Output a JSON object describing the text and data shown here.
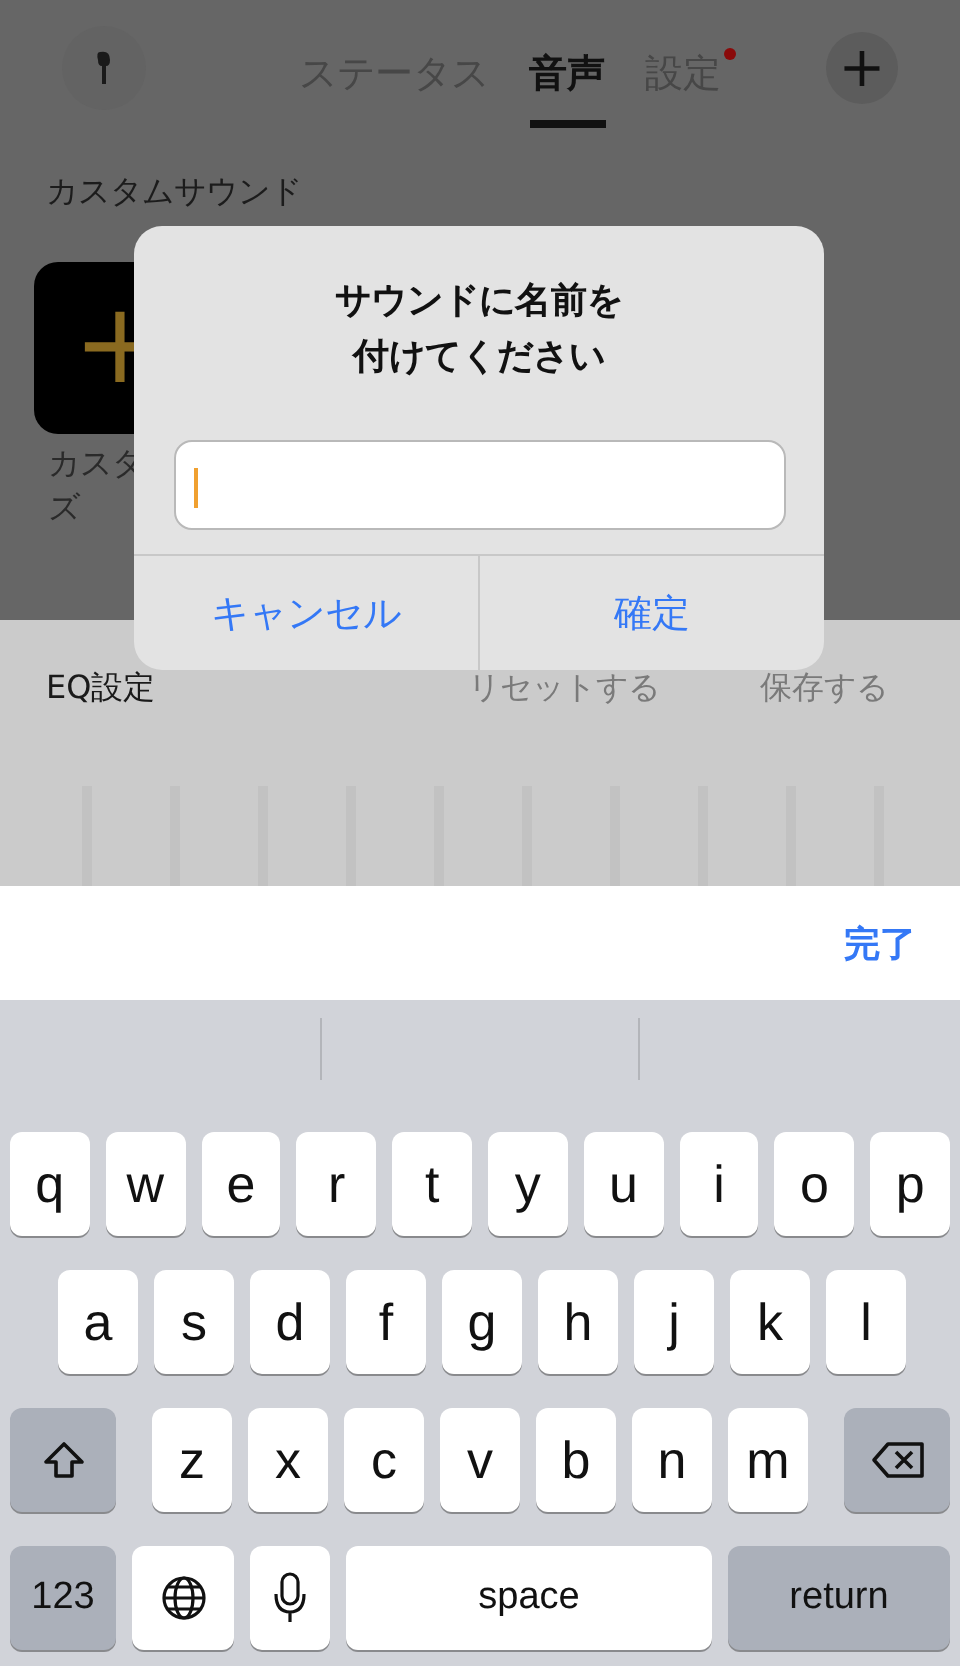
{
  "header": {
    "tabs": [
      {
        "label": "ステータス",
        "selected": false,
        "dot": false
      },
      {
        "label": "音声",
        "selected": true,
        "dot": false
      },
      {
        "label": "設定",
        "selected": false,
        "dot": true
      }
    ],
    "add_button": "+"
  },
  "custom_sound": {
    "title": "カスタムサウンド",
    "tile": {
      "icon": "+",
      "label_lines": [
        "カスタ",
        "ズ"
      ]
    }
  },
  "eq": {
    "title": "EQ設定",
    "reset": "リセットする",
    "save": "保存する"
  },
  "dialog": {
    "title_lines": [
      "サウンドに名前を",
      "付けてください"
    ],
    "buttons": [
      {
        "label": "キャンセル",
        "bold": false
      },
      {
        "label": "確定",
        "bold": false
      }
    ]
  },
  "toolbar": {
    "done": "完了"
  },
  "keyboard": {
    "rows": [
      [
        "q",
        "w",
        "e",
        "r",
        "t",
        "y",
        "u",
        "i",
        "o",
        "p"
      ],
      [
        "a",
        "s",
        "d",
        "f",
        "g",
        "h",
        "j",
        "k",
        "l"
      ],
      [
        "z",
        "x",
        "c",
        "v",
        "b",
        "n",
        "m"
      ]
    ],
    "numbers": "123",
    "space": "space",
    "return": "return"
  }
}
